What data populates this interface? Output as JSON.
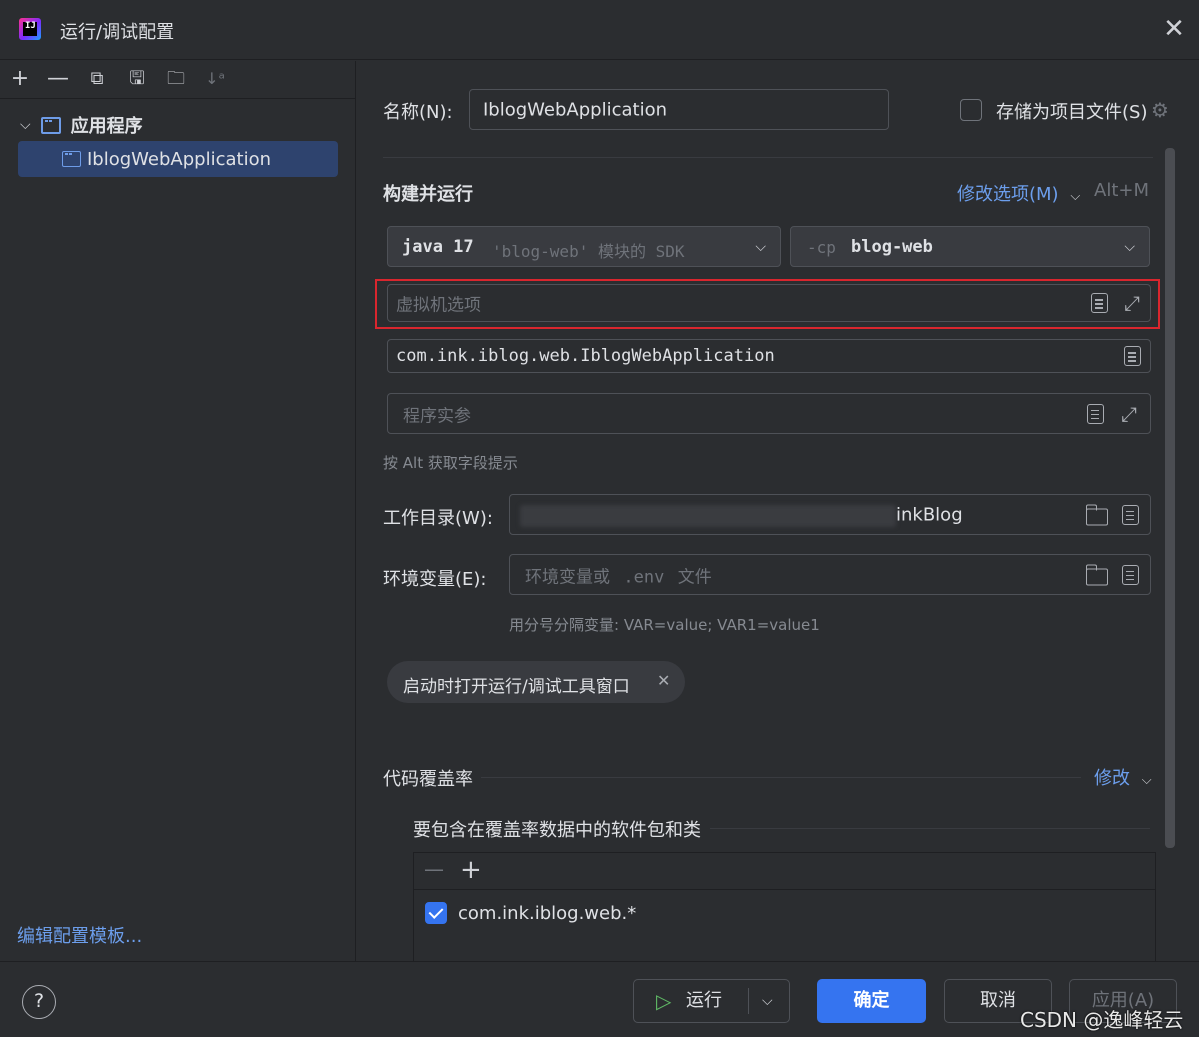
{
  "window": {
    "title": "运行/调试配置"
  },
  "left_toolbar": {
    "icons": [
      "add-icon",
      "remove-icon",
      "copy-icon",
      "save-icon",
      "new-folder-icon",
      "sort-icon"
    ]
  },
  "tree": {
    "group_label": "应用程序",
    "items": [
      {
        "label": "IblogWebApplication",
        "selected": true
      }
    ]
  },
  "left_footer": {
    "edit_templates": "编辑配置模板..."
  },
  "form": {
    "name_label": "名称(N):",
    "name_value": "IblogWebApplication",
    "store_as_project_label": "存储为项目文件(S)",
    "store_as_project_checked": false,
    "section_build_run": "构建并运行",
    "modify_options": "修改选项(M)",
    "modify_shortcut": "Alt+M",
    "sdk_main": "java 17",
    "sdk_hint": "'blog-web' 模块的 SDK",
    "cp_prefix": "-cp",
    "cp_value": "blog-web",
    "vm_options_placeholder": "虚拟机选项",
    "main_class": "com.ink.iblog.web.IblogWebApplication",
    "program_args_placeholder": "程序实参",
    "alt_hint": "按 Alt 获取字段提示",
    "workdir_label": "工作目录(W):",
    "workdir_value_visible": "inkBlog",
    "env_label": "环境变量(E):",
    "env_placeholder_1": "环境变量或",
    "env_placeholder_2": ".env",
    "env_placeholder_3": "文件",
    "env_hint": "用分号分隔变量: VAR=value; VAR1=value1",
    "chip_label": "启动时打开运行/调试工具窗口",
    "coverage_section": "代码覆盖率",
    "coverage_modify": "修改",
    "coverage_packages_title": "要包含在覆盖率数据中的软件包和类",
    "coverage_items": [
      {
        "pattern": "com.ink.iblog.web.*",
        "checked": true
      }
    ]
  },
  "footer": {
    "run_label": "运行",
    "ok_label": "确定",
    "cancel_label": "取消",
    "apply_label": "应用(A)",
    "watermark": "CSDN @逸峰轻云"
  },
  "colors": {
    "accent": "#3574f0",
    "link": "#6c9eec",
    "highlight_box": "#d9262e",
    "selection": "#2e436e"
  }
}
